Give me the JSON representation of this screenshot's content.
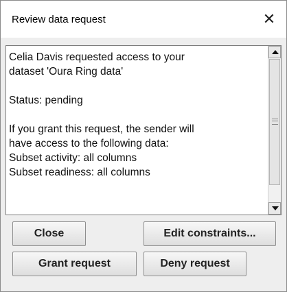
{
  "dialog": {
    "title": "Review data request",
    "close_glyph": "✕"
  },
  "message": {
    "line1": "Celia Davis requested access to your",
    "line2": "dataset 'Oura Ring data'",
    "status": "Status: pending",
    "line4": "If you grant this request, the sender will",
    "line5": "have access to the following data:",
    "line6": "Subset activity: all columns",
    "line7": "Subset readiness: all columns"
  },
  "buttons": {
    "close": "Close",
    "edit_constraints": "Edit constraints...",
    "grant": "Grant request",
    "deny": "Deny request"
  },
  "icons": {
    "scroll_up": "scroll-up-arrow-icon",
    "scroll_down": "scroll-down-arrow-icon",
    "thumb_grip": "scrollbar-grip-icon",
    "window_close": "close-icon"
  }
}
